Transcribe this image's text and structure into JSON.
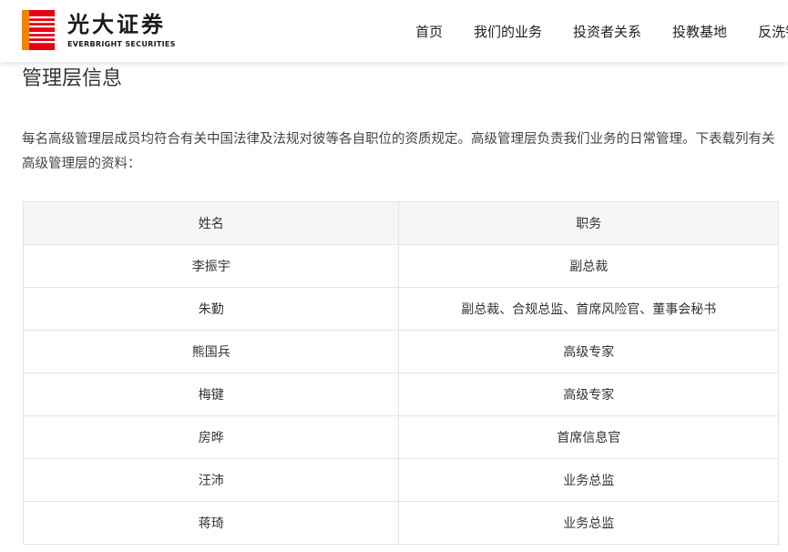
{
  "brand": {
    "name_cn": "光大证券",
    "name_en": "EVERBRIGHT SECURITIES",
    "colors": {
      "accent_red": "#e60012",
      "accent_orange": "#f08300"
    }
  },
  "nav": {
    "items": [
      {
        "label": "首页"
      },
      {
        "label": "我们的业务"
      },
      {
        "label": "投资者关系"
      },
      {
        "label": "投教基地"
      },
      {
        "label": "反洗钱"
      }
    ]
  },
  "page": {
    "title": "管理层信息",
    "intro": "每名高级管理层成员均符合有关中国法律及法规对彼等各自职位的资质规定。高级管理层负责我们业务的日常管理。下表载列有关高级管理层的资料："
  },
  "table": {
    "headers": [
      "姓名",
      "职务"
    ],
    "rows": [
      {
        "name": "李振宇",
        "position": "副总裁"
      },
      {
        "name": "朱勤",
        "position": "副总裁、合规总监、首席风险官、董事会秘书"
      },
      {
        "name": "熊国兵",
        "position": "高级专家"
      },
      {
        "name": "梅键",
        "position": "高级专家"
      },
      {
        "name": "房晔",
        "position": "首席信息官"
      },
      {
        "name": "汪沛",
        "position": "业务总监"
      },
      {
        "name": "蒋琦",
        "position": "业务总监"
      }
    ]
  }
}
